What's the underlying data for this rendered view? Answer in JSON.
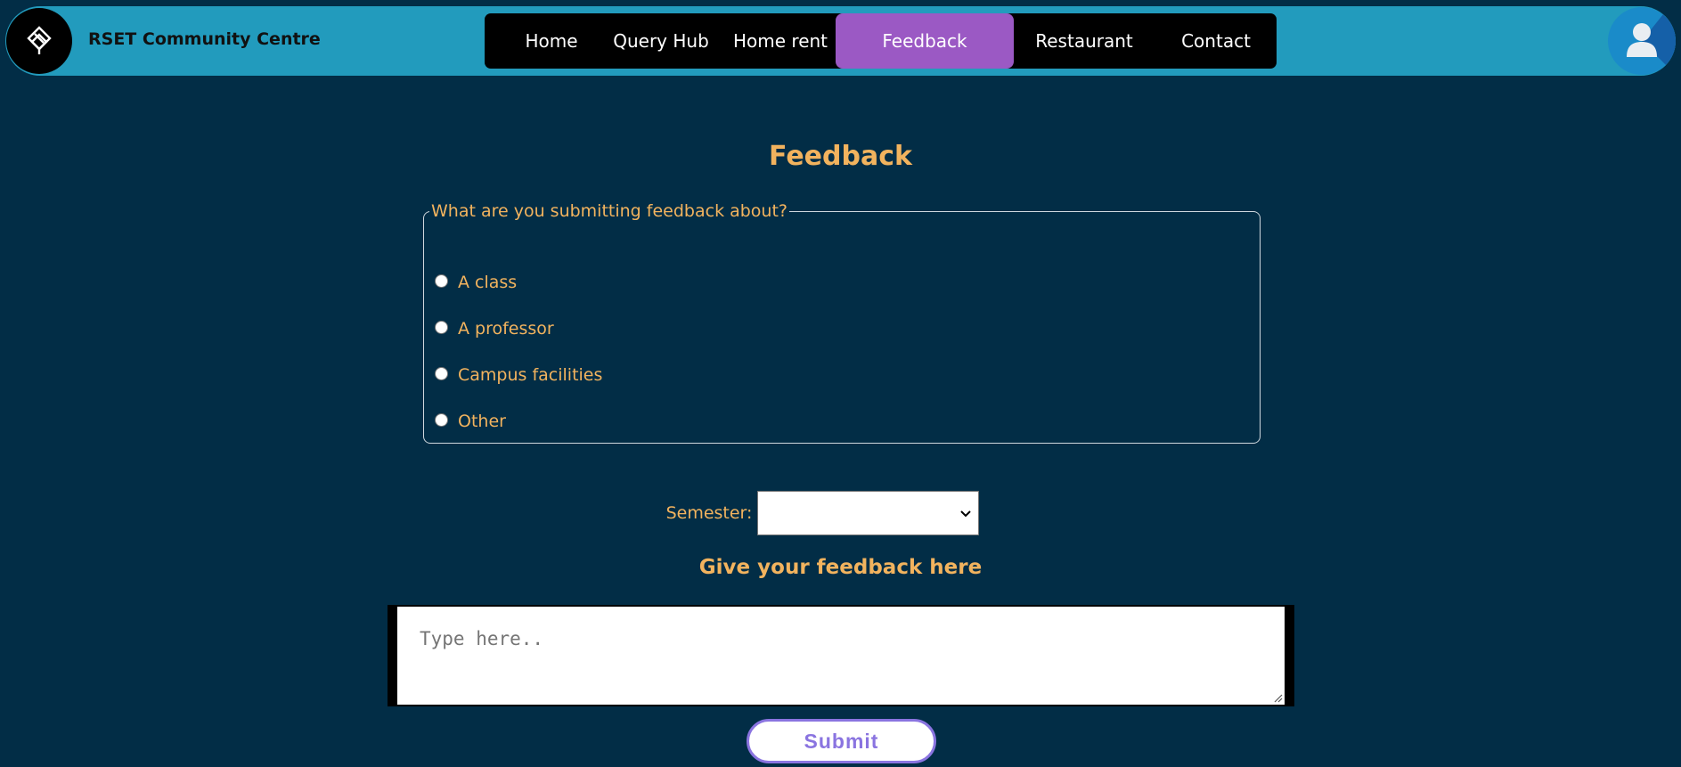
{
  "header": {
    "brand": "RSET Community Centre",
    "logo_icon": "diamond-logo-icon",
    "avatar_icon": "user-avatar-icon",
    "nav": [
      {
        "label": "Home",
        "active": false
      },
      {
        "label": "Query Hub",
        "active": false
      },
      {
        "label": "Home rent",
        "active": false
      },
      {
        "label": "Feedback",
        "active": true
      },
      {
        "label": "Restaurant",
        "active": false
      },
      {
        "label": "Contact",
        "active": false
      }
    ]
  },
  "main": {
    "title": "Feedback",
    "fieldset_legend": "What are you submitting feedback about?",
    "options": [
      "A class",
      "A professor",
      "Campus facilities",
      "Other"
    ],
    "semester_label": "Semester:",
    "semester_value": "",
    "feedback_heading": "Give your feedback here",
    "textarea_placeholder": "Type here..",
    "submit_label": "Submit"
  },
  "colors": {
    "background": "#022d46",
    "header": "#229bbd",
    "nav_active": "#9b59c4",
    "accent_text": "#f2b35e",
    "submit": "#8a74e0"
  }
}
